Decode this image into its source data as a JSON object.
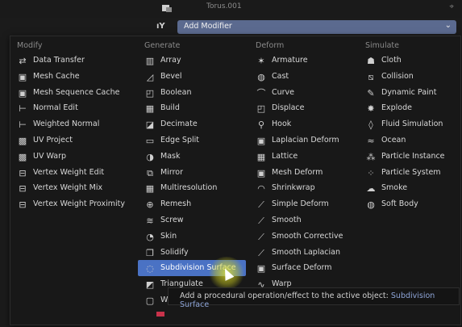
{
  "topbar": {
    "object_name": "Torus.001"
  },
  "modifier_button": {
    "label": "Add Modifier"
  },
  "columns": [
    {
      "header": "Modify",
      "items": [
        {
          "label": "Data Transfer",
          "icon": "data-transfer-icon"
        },
        {
          "label": "Mesh Cache",
          "icon": "mesh-cache-icon"
        },
        {
          "label": "Mesh Sequence Cache",
          "icon": "mesh-sequence-cache-icon"
        },
        {
          "label": "Normal Edit",
          "icon": "normal-edit-icon"
        },
        {
          "label": "Weighted Normal",
          "icon": "weighted-normal-icon"
        },
        {
          "label": "UV Project",
          "icon": "uv-project-icon"
        },
        {
          "label": "UV Warp",
          "icon": "uv-warp-icon"
        },
        {
          "label": "Vertex Weight Edit",
          "icon": "vertex-weight-edit-icon"
        },
        {
          "label": "Vertex Weight Mix",
          "icon": "vertex-weight-mix-icon"
        },
        {
          "label": "Vertex Weight Proximity",
          "icon": "vertex-weight-proximity-icon"
        }
      ]
    },
    {
      "header": "Generate",
      "items": [
        {
          "label": "Array",
          "icon": "array-icon"
        },
        {
          "label": "Bevel",
          "icon": "bevel-icon"
        },
        {
          "label": "Boolean",
          "icon": "boolean-icon"
        },
        {
          "label": "Build",
          "icon": "build-icon"
        },
        {
          "label": "Decimate",
          "icon": "decimate-icon"
        },
        {
          "label": "Edge Split",
          "icon": "edge-split-icon"
        },
        {
          "label": "Mask",
          "icon": "mask-icon"
        },
        {
          "label": "Mirror",
          "icon": "mirror-icon"
        },
        {
          "label": "Multiresolution",
          "icon": "multiresolution-icon"
        },
        {
          "label": "Remesh",
          "icon": "remesh-icon"
        },
        {
          "label": "Screw",
          "icon": "screw-icon"
        },
        {
          "label": "Skin",
          "icon": "skin-icon"
        },
        {
          "label": "Solidify",
          "icon": "solidify-icon"
        },
        {
          "label": "Subdivision Surface",
          "icon": "subdivision-surface-icon",
          "highlighted": true
        },
        {
          "label": "Triangulate",
          "icon": "triangulate-icon"
        },
        {
          "label": "Wi",
          "icon": "wireframe-icon"
        }
      ]
    },
    {
      "header": "Deform",
      "items": [
        {
          "label": "Armature",
          "icon": "armature-icon"
        },
        {
          "label": "Cast",
          "icon": "cast-icon"
        },
        {
          "label": "Curve",
          "icon": "curve-icon"
        },
        {
          "label": "Displace",
          "icon": "displace-icon"
        },
        {
          "label": "Hook",
          "icon": "hook-icon"
        },
        {
          "label": "Laplacian Deform",
          "icon": "laplacian-deform-icon"
        },
        {
          "label": "Lattice",
          "icon": "lattice-icon"
        },
        {
          "label": "Mesh Deform",
          "icon": "mesh-deform-icon"
        },
        {
          "label": "Shrinkwrap",
          "icon": "shrinkwrap-icon"
        },
        {
          "label": "Simple Deform",
          "icon": "simple-deform-icon"
        },
        {
          "label": "Smooth",
          "icon": "smooth-icon"
        },
        {
          "label": "Smooth Corrective",
          "icon": "smooth-corrective-icon"
        },
        {
          "label": "Smooth Laplacian",
          "icon": "smooth-laplacian-icon"
        },
        {
          "label": "Surface Deform",
          "icon": "surface-deform-icon"
        },
        {
          "label": "Warp",
          "icon": "warp-icon"
        }
      ]
    },
    {
      "header": "Simulate",
      "items": [
        {
          "label": "Cloth",
          "icon": "cloth-icon"
        },
        {
          "label": "Collision",
          "icon": "collision-icon"
        },
        {
          "label": "Dynamic Paint",
          "icon": "dynamic-paint-icon"
        },
        {
          "label": "Explode",
          "icon": "explode-icon"
        },
        {
          "label": "Fluid Simulation",
          "icon": "fluid-simulation-icon"
        },
        {
          "label": "Ocean",
          "icon": "ocean-icon"
        },
        {
          "label": "Particle Instance",
          "icon": "particle-instance-icon"
        },
        {
          "label": "Particle System",
          "icon": "particle-system-icon"
        },
        {
          "label": "Smoke",
          "icon": "smoke-icon"
        },
        {
          "label": "Soft Body",
          "icon": "soft-body-icon"
        }
      ]
    }
  ],
  "tooltip": {
    "text": "Add a procedural operation/effect to the active object:",
    "target": "Subdivision Surface"
  },
  "colors": {
    "highlight": "#4a72c4",
    "add_button": "#5b6a8f",
    "tooltip_target": "#8ea5d8"
  }
}
